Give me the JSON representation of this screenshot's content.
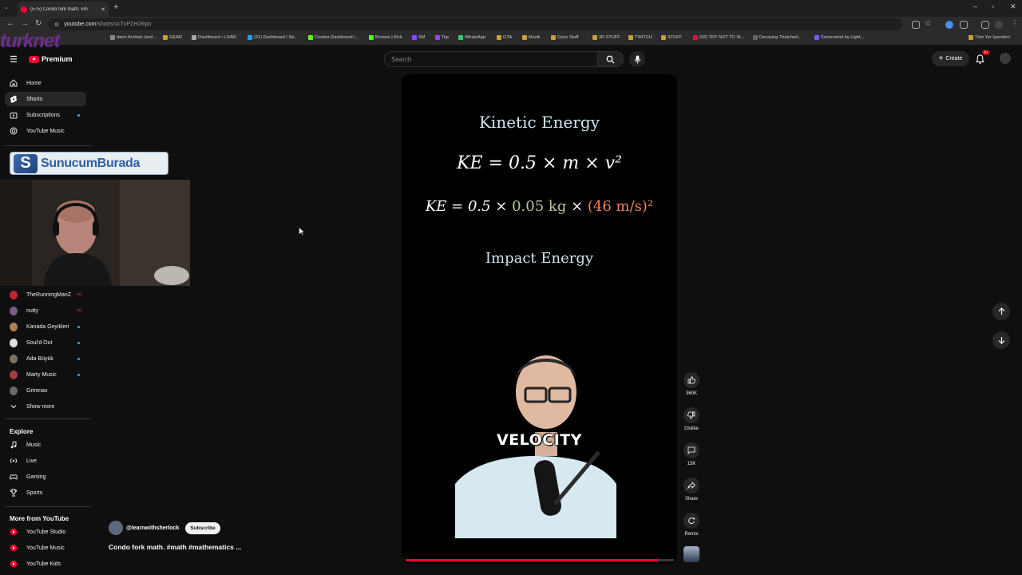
{
  "browser": {
    "tab_title": "(575) Condo fork math. #m",
    "url_domain": "youtube.com",
    "url_path": "/shorts/ucTvPZH2Rpo",
    "bookmarks": [
      "darm Archive (and...",
      "GEAR",
      "Dashboard • LIVAD",
      "(21) Dashboard / Str...",
      "Creator Dashboard |...",
      "Browse | Kick",
      "SM",
      "Top",
      "WhatsApp",
      "GTA",
      "Muzik",
      "Oyun Stuff",
      "3D STUFF",
      "TWITCH",
      "STUFF",
      "(93) TRY NOT TO St...",
      "Decaying Thatched...",
      "Screenshot by Light...",
      "Tüm Yer İşaretleri"
    ],
    "watermark": "turknet"
  },
  "header": {
    "logo_text": "Premium",
    "search_placeholder": "Search",
    "create_label": "Create",
    "notification_count": "9+"
  },
  "sidebar": {
    "primary": [
      {
        "label": "Home",
        "icon": "home-icon"
      },
      {
        "label": "Shorts",
        "icon": "shorts-icon"
      },
      {
        "label": "Subscriptions",
        "icon": "subscriptions-icon"
      },
      {
        "label": "YouTube Music",
        "icon": "music-circle-icon"
      }
    ],
    "subscriptions": [
      {
        "label": "TheRunningManZ",
        "live": "(•)",
        "color": "#c1272d"
      },
      {
        "label": "nutty",
        "live": "(•)",
        "color": "#7a5a8a"
      },
      {
        "label": "Kanada Geyikleri",
        "color": "#b08050"
      },
      {
        "label": "Soul'd Out",
        "color": "#e0e0e0"
      },
      {
        "label": "Ada Büyük",
        "color": "#807060"
      },
      {
        "label": "Marty Music",
        "color": "#a04040"
      },
      {
        "label": "Grimnax",
        "color": "#6a6a6a"
      }
    ],
    "show_more": "Show more",
    "explore_heading": "Explore",
    "explore": [
      {
        "label": "Music",
        "icon": "music-note-icon"
      },
      {
        "label": "Live",
        "icon": "live-icon"
      },
      {
        "label": "Gaming",
        "icon": "gaming-icon"
      },
      {
        "label": "Sports",
        "icon": "trophy-icon"
      }
    ],
    "more_heading": "More from YouTube",
    "more": [
      {
        "label": "YouTube Studio"
      },
      {
        "label": "YouTube Music"
      },
      {
        "label": "YouTube Kids"
      }
    ]
  },
  "overlay": {
    "banner_text": "SunucumBurada"
  },
  "short": {
    "eq_title": "Kinetic Energy",
    "eq_formula": "KE = 0.5 × m × v²",
    "eq_values_prefix": "KE = 0.5 × ",
    "eq_mass": "0.05 kg",
    "eq_times": " × ",
    "eq_velocity": "(46 m/s)²",
    "eq_impact": "Impact Energy",
    "caption": "VELOCITY",
    "progress_fraction": 0.94,
    "channel_handle": "@learnwithsherlock",
    "subscribe_label": "Subscribe",
    "title": "Condo fork math. #math #mathematics ..."
  },
  "actions": {
    "like_count": "360K",
    "dislike_label": "Dislike",
    "comment_count": "13K",
    "share_label": "Share",
    "remix_label": "Remix"
  },
  "colors": {
    "accent_red": "#ff0033",
    "background": "#0f0f0f",
    "equation_mass": "#b6c89a",
    "equation_velocity": "#e8865c"
  }
}
